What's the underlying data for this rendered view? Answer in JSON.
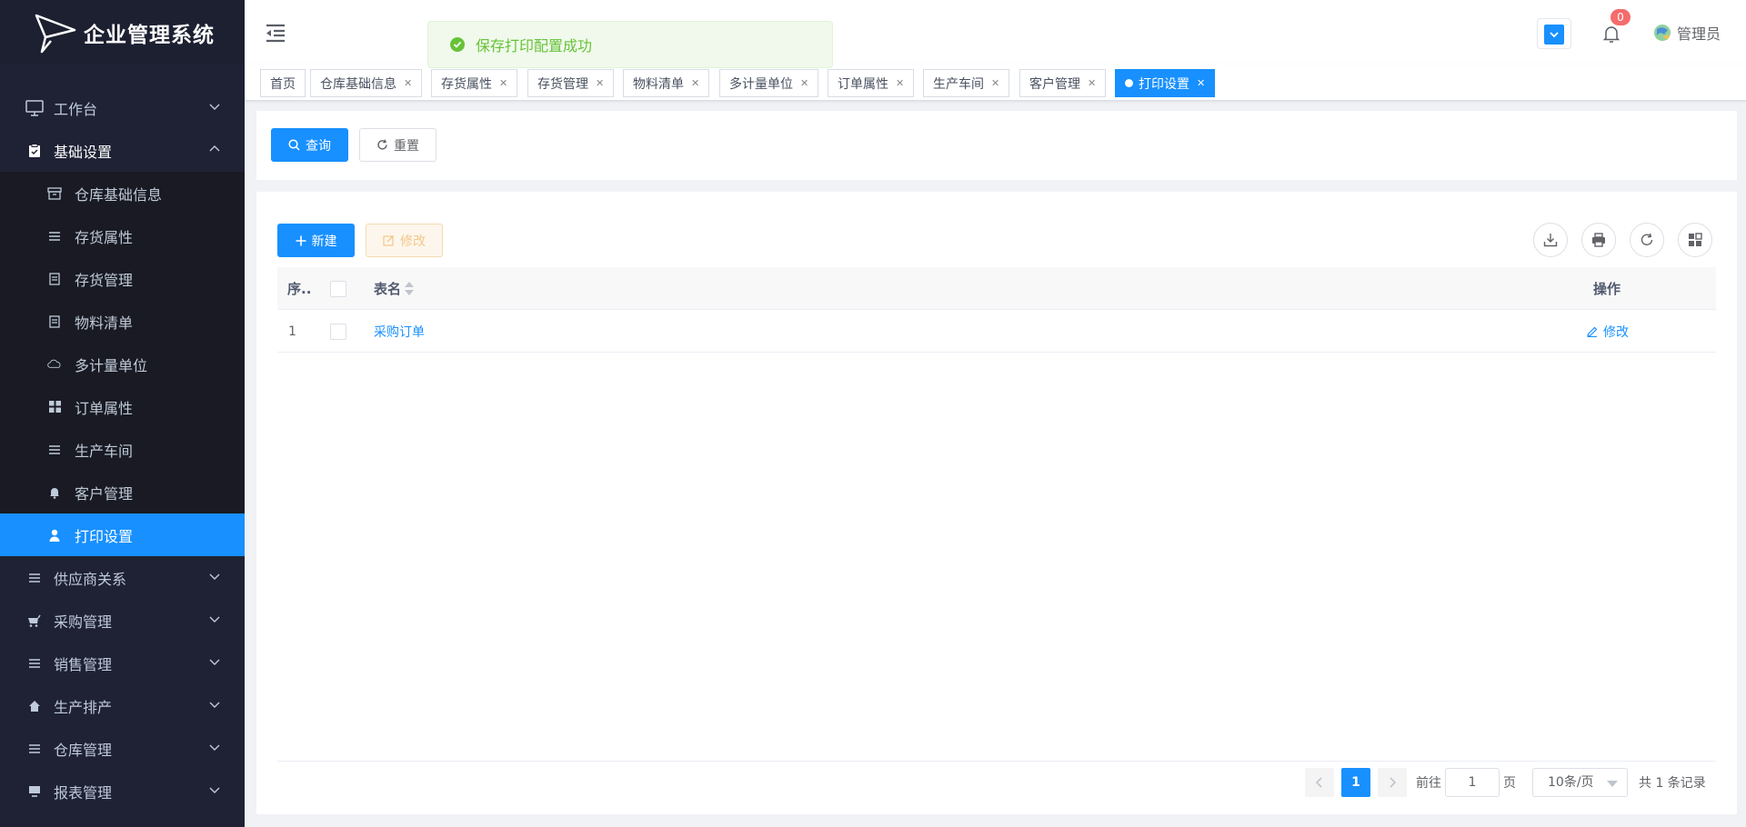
{
  "app": {
    "title": "企业管理系统"
  },
  "sidebar": {
    "items": [
      {
        "label": "工作台",
        "icon": "monitor-icon",
        "expanded": false
      },
      {
        "label": "基础设置",
        "icon": "clipboard-icon",
        "expanded": true
      },
      {
        "label": "供应商关系",
        "icon": "list-icon",
        "expanded": false
      },
      {
        "label": "采购管理",
        "icon": "cart-icon",
        "expanded": false
      },
      {
        "label": "销售管理",
        "icon": "list-icon",
        "expanded": false
      },
      {
        "label": "生产排产",
        "icon": "home-icon",
        "expanded": false
      },
      {
        "label": "仓库管理",
        "icon": "list-icon",
        "expanded": false
      },
      {
        "label": "报表管理",
        "icon": "monitor-icon",
        "expanded": false
      }
    ],
    "sub_items": [
      {
        "label": "仓库基础信息",
        "icon": "archive-icon"
      },
      {
        "label": "存货属性",
        "icon": "list-icon"
      },
      {
        "label": "存货管理",
        "icon": "document-icon"
      },
      {
        "label": "物料清单",
        "icon": "document-icon"
      },
      {
        "label": "多计量单位",
        "icon": "cloud-icon"
      },
      {
        "label": "订单属性",
        "icon": "grid-icon"
      },
      {
        "label": "生产车间",
        "icon": "list-icon"
      },
      {
        "label": "客户管理",
        "icon": "bell-icon"
      },
      {
        "label": "打印设置",
        "icon": "user-icon",
        "active": true
      }
    ]
  },
  "header": {
    "notification_count": "0",
    "username": "管理员"
  },
  "toast": {
    "message": "保存打印配置成功",
    "type": "success"
  },
  "tags": [
    {
      "label": "首页"
    },
    {
      "label": "仓库基础信息"
    },
    {
      "label": "存货属性"
    },
    {
      "label": "存货管理"
    },
    {
      "label": "物料清单"
    },
    {
      "label": "多计量单位"
    },
    {
      "label": "订单属性"
    },
    {
      "label": "生产车间"
    },
    {
      "label": "客户管理"
    },
    {
      "label": "打印设置",
      "active": true
    }
  ],
  "search": {
    "query_label": "查询",
    "reset_label": "重置"
  },
  "toolbar": {
    "new_label": "新建",
    "edit_label": "修改"
  },
  "table": {
    "columns": {
      "index": "序..",
      "name": "表名",
      "action": "操作"
    },
    "rows": [
      {
        "index": "1",
        "name": "采购订单",
        "action": "修改"
      }
    ]
  },
  "pagination": {
    "current_page": "1",
    "goto_prefix": "前往",
    "goto_value": "1",
    "goto_suffix": "页",
    "page_size": "10条/页",
    "total_text": "共 1 条记录"
  },
  "colors": {
    "primary": "#1890ff",
    "sidebar_bg": "#1f2235",
    "success": "#67c23a",
    "danger": "#f56c6c"
  }
}
